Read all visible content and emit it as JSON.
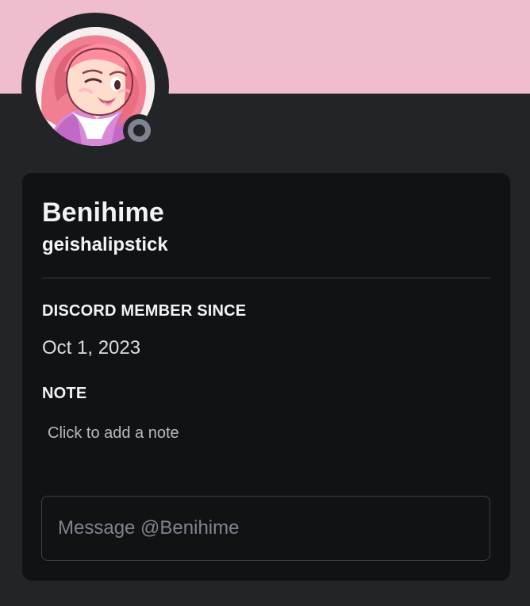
{
  "profile": {
    "display_name": "Benihime",
    "username": "geishalipstick"
  },
  "sections": {
    "member_since_title": "DISCORD MEMBER SINCE",
    "member_since_value": "Oct 1, 2023",
    "note_title": "NOTE",
    "note_placeholder": "Click to add a note"
  },
  "message": {
    "placeholder": "Message @Benihime",
    "value": ""
  },
  "colors": {
    "banner": "#efbdcd",
    "panel_background": "#232428",
    "card_background": "#111214",
    "status_offline": "#80848e"
  },
  "icons": {
    "status": "offline-status-icon"
  }
}
